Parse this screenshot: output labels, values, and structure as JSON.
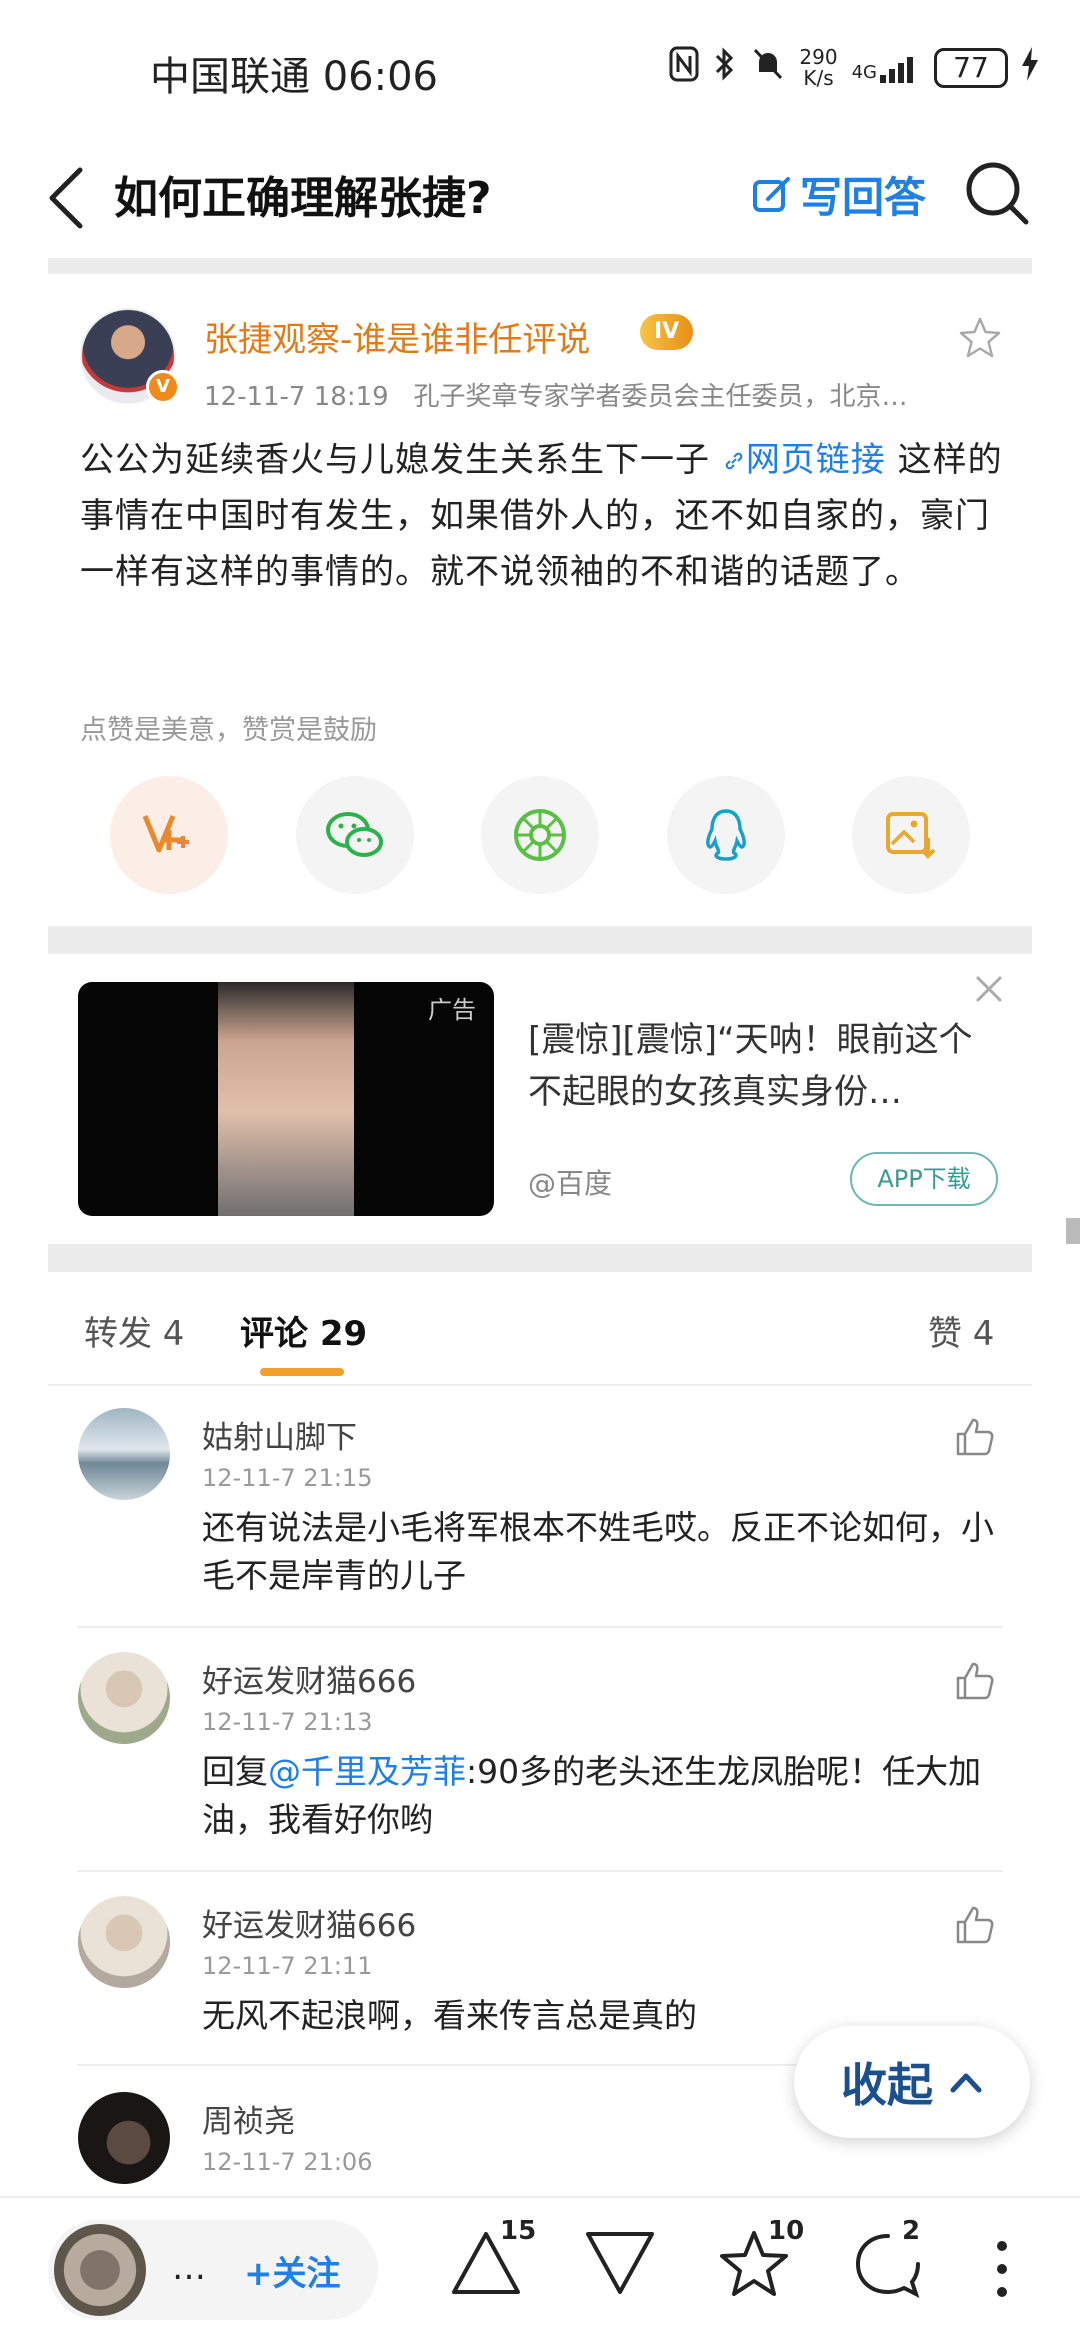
{
  "status_bar": {
    "carrier_time": "中国联通 06:06",
    "net_speed_value": "290",
    "net_speed_unit": "K/s",
    "network": "4G",
    "battery": "77"
  },
  "nav": {
    "title": "如何正确理解张捷?",
    "write_answer": "写回答"
  },
  "post": {
    "author": "张捷观察-谁是谁非任评说",
    "level": "IV",
    "timestamp": "12-11-7 18:19",
    "author_desc": "孔子奖章专家学者委员会主任委员，北京…",
    "body_before_link": "公公为延续香火与儿媳发生关系生下一子 ",
    "link_label": "网页链接",
    "body_after_link": " 这样的事情在中国时有发生，如果借外人的，还不如自家的，豪门一样有这样的事情的。就不说领袖的不和谐的话题了。",
    "praise_hint": "点赞是美意，赞赏是鼓励",
    "share_icons": [
      "reward-v-icon",
      "wechat-icon",
      "moments-icon",
      "qq-icon",
      "save-image-icon"
    ]
  },
  "ad": {
    "tag": "广告",
    "text": "[震惊][震惊]“天呐！眼前这个不起眼的女孩真实身份…",
    "source": "@百度",
    "button": "APP下载"
  },
  "tabs": {
    "repost": "转发 4",
    "comments": "评论 29",
    "likes": "赞 4"
  },
  "comments": [
    {
      "name": "姑射山脚下",
      "time": "12-11-7 21:15",
      "text": "还有说法是小毛将军根本不姓毛哎。反正不论如何，小毛不是岸青的儿子"
    },
    {
      "name": "好运发财猫666",
      "time": "12-11-7 21:13",
      "reply_prefix": "回复",
      "mention": "@千里及芳菲",
      "text": ":90多的老头还生龙凤胎呢！任大加油，我看好你哟"
    },
    {
      "name": "好运发财猫666",
      "time": "12-11-7 21:11",
      "text": "无风不起浪啊，看来传言总是真的"
    },
    {
      "name": "周祯尧",
      "time": "12-11-7 21:06",
      "text": ""
    }
  ],
  "collapse_label": "收起",
  "bottom_bar": {
    "ellipsis": "…",
    "follow": "+关注",
    "upvote_count": "15",
    "favorite_count": "10",
    "comment_count": "2"
  },
  "colors": {
    "accent_blue": "#1e7fe4",
    "author_orange": "#e07b17",
    "tab_underline": "#f1a12b"
  }
}
